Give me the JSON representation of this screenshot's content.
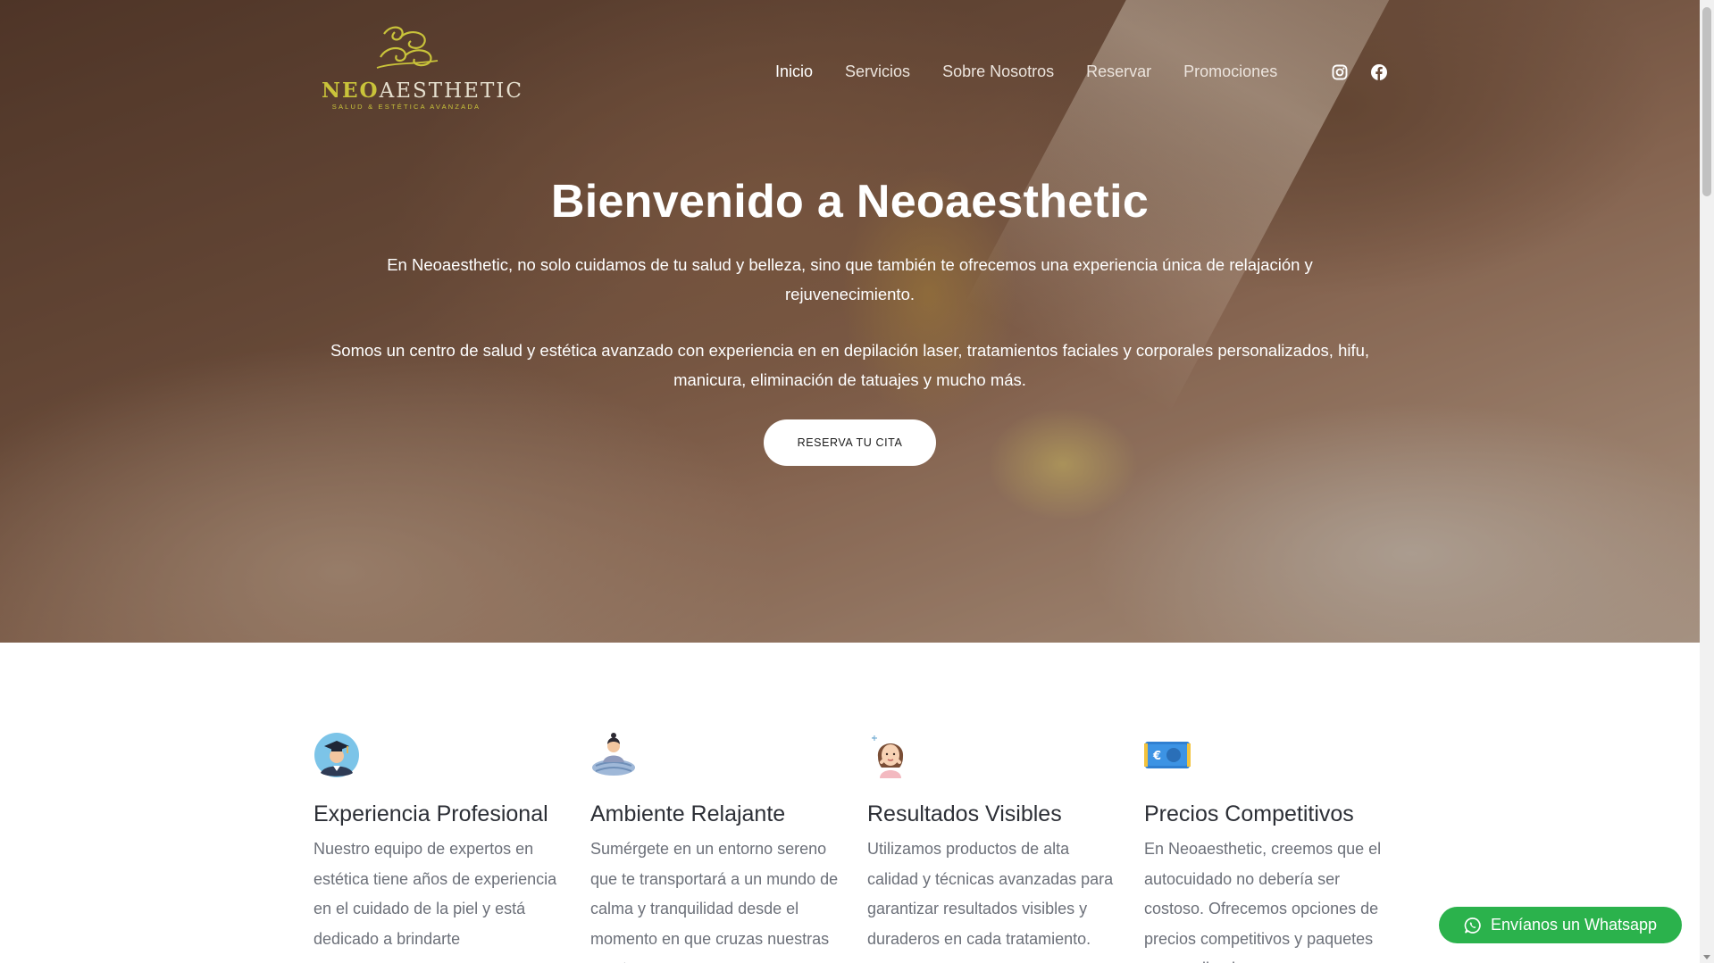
{
  "brand": {
    "neo": "NEO",
    "aesthetic": "AESTHETIC",
    "tagline": "SALUD & ESTÉTICA AVANZADA",
    "accent": "#c9c33a"
  },
  "nav": {
    "items": [
      {
        "label": "Inicio",
        "active": true
      },
      {
        "label": "Servicios"
      },
      {
        "label": "Sobre Nosotros"
      },
      {
        "label": "Reservar"
      },
      {
        "label": "Promociones"
      }
    ],
    "social_icons": [
      "instagram-icon",
      "facebook-icon"
    ]
  },
  "hero": {
    "title": "Bienvenido a Neoaesthetic",
    "paragraph1": "En Neoaesthetic, no solo cuidamos de tu salud y belleza, sino que también te ofrecemos una experiencia única de relajación y rejuvenecimiento.",
    "paragraph2": "Somos un centro de salud y estética avanzado con experiencia en en depilación laser, tratamientos faciales y corporales personalizados, hifu, manicura, eliminación de tatuajes y mucho más.",
    "cta": "RESERVA TU CITA"
  },
  "features": [
    {
      "icon": "graduate-icon",
      "title": "Experiencia Profesional",
      "text": "Nuestro equipo de expertos en estética tiene años de experiencia en el cuidado de la piel y está dedicado a brindarte"
    },
    {
      "icon": "relax-icon",
      "title": "Ambiente Relajante",
      "text": "Sumérgete en un entorno sereno que te transportará a un mundo de calma y tranquilidad desde el momento en que cruzas nuestras puertas."
    },
    {
      "icon": "woman-face-icon",
      "title": "Resultados Visibles",
      "text": "Utilizamos productos de alta calidad y técnicas avanzadas para garantizar resultados visibles y duraderos en cada tratamiento."
    },
    {
      "icon": "euro-banknote-icon",
      "title": "Precios Competitivos",
      "text": "En Neoaesthetic, creemos que el autocuidado no debería ser costoso. Ofrecemos opciones de precios competitivos y paquetes personalizados"
    }
  ],
  "whatsapp": {
    "label": "Envíanos un Whatsapp",
    "color": "#2bb24c"
  }
}
